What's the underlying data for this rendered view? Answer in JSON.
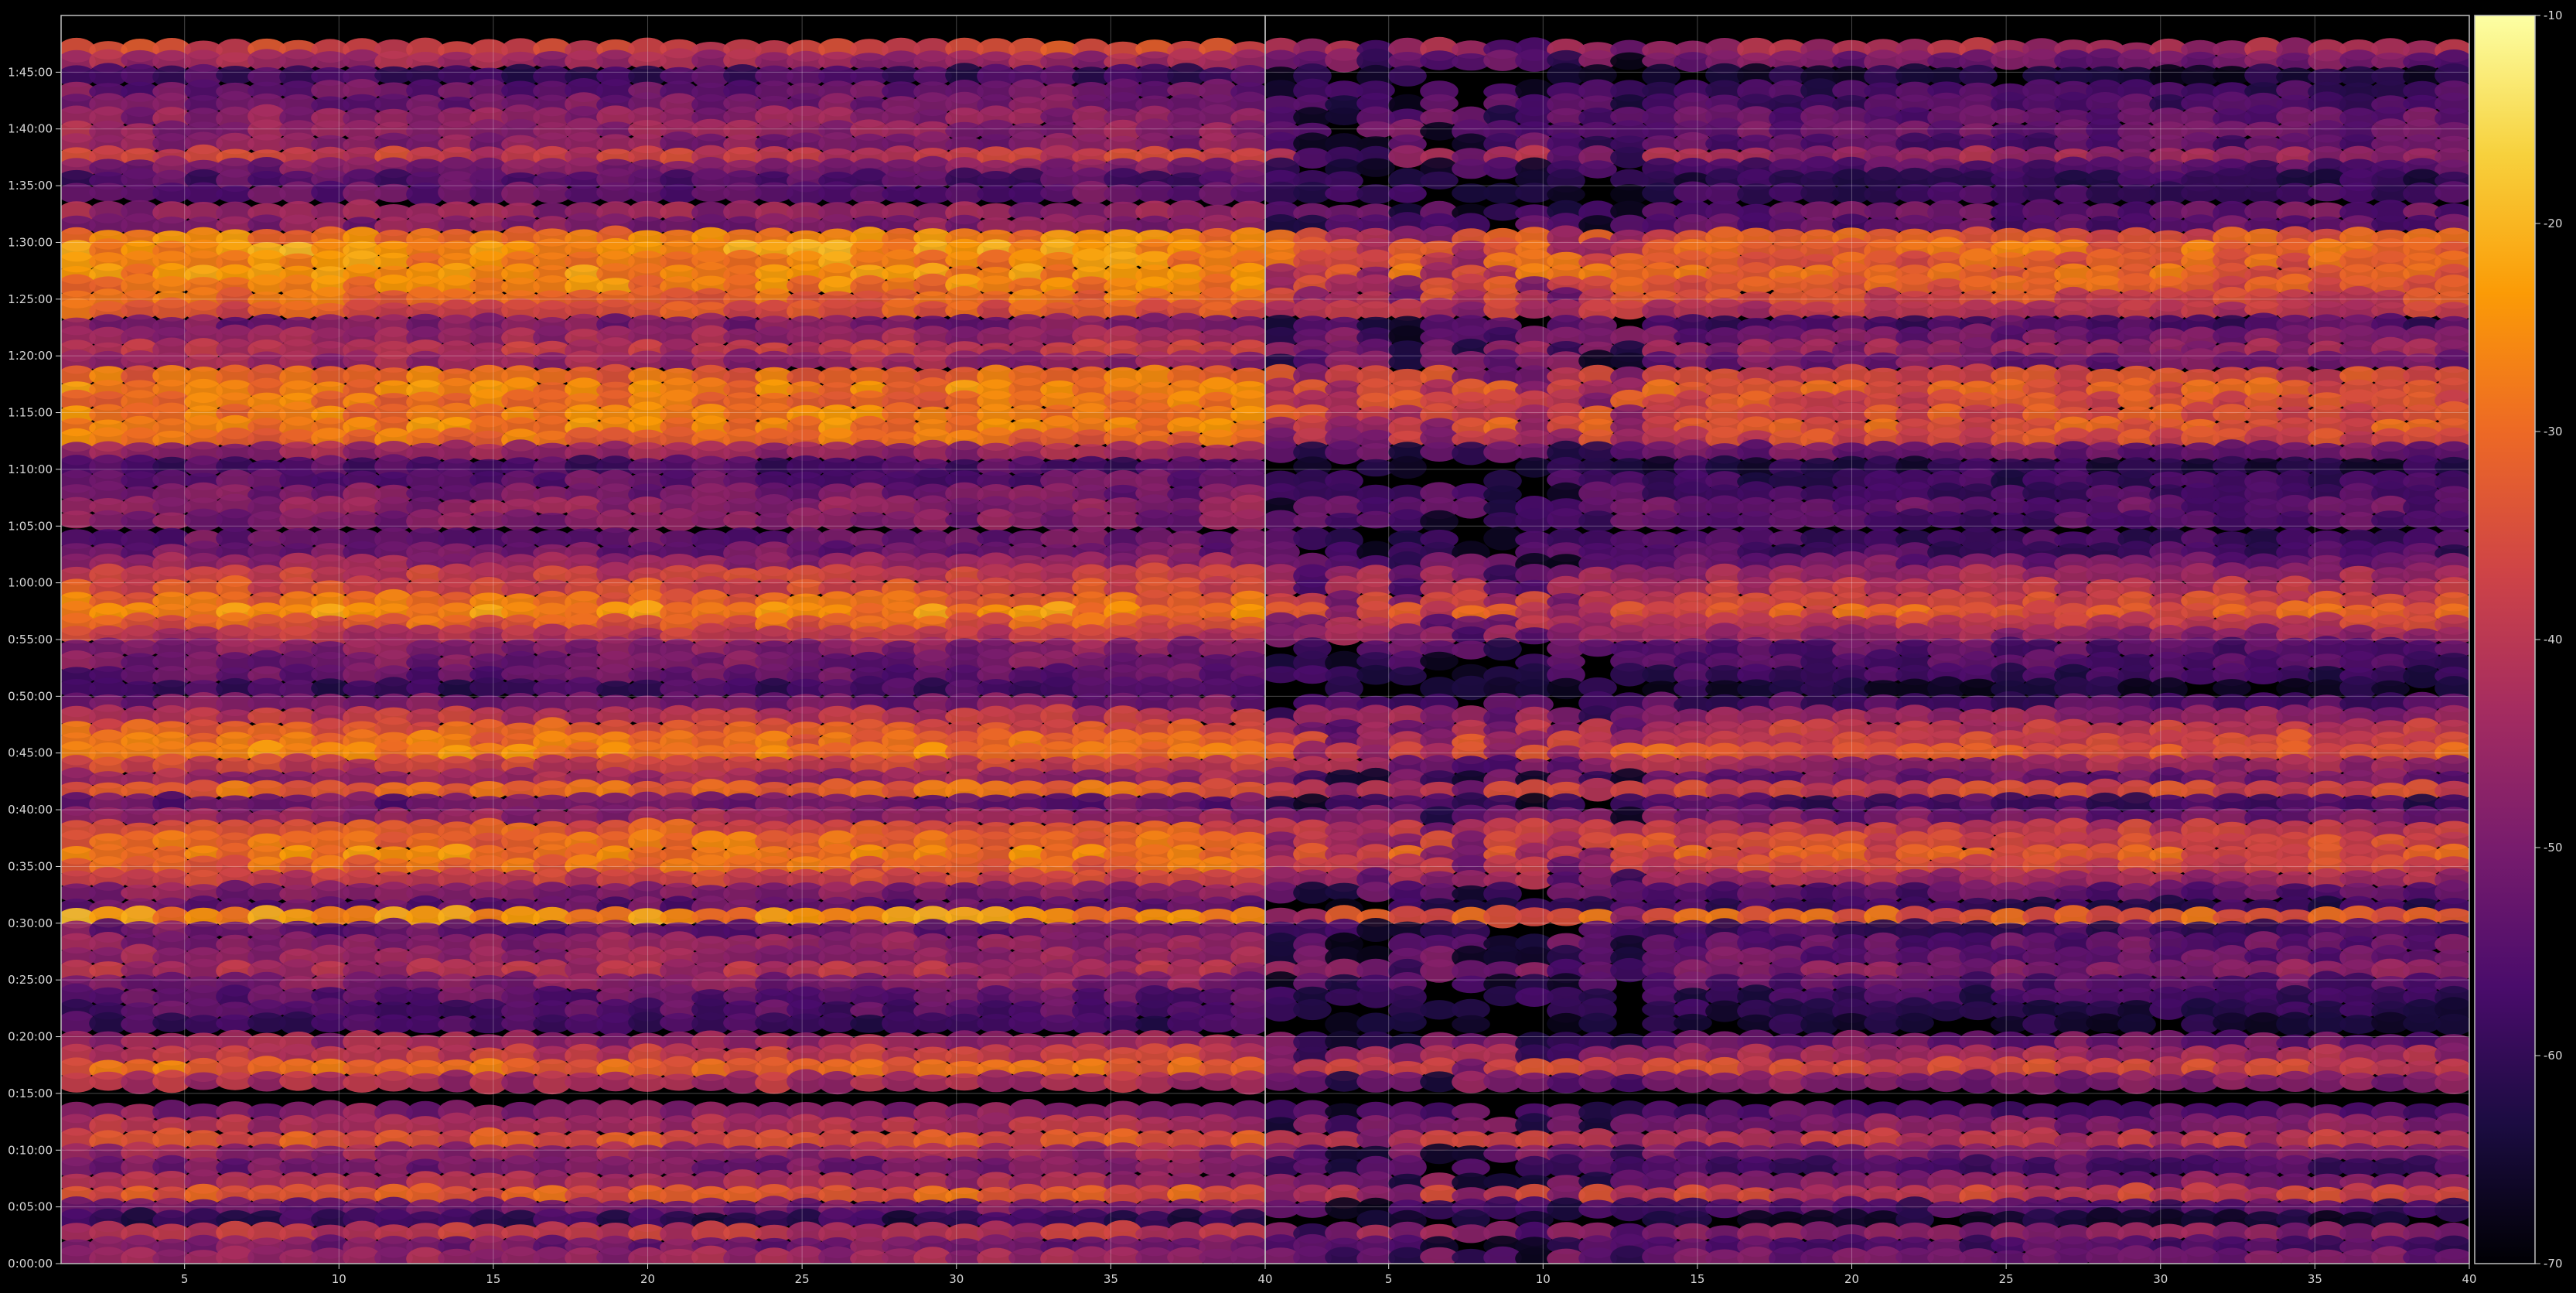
{
  "chart_data": {
    "type": "heatmap",
    "title": "",
    "xlabel": "",
    "ylabel": "",
    "grid": true,
    "background": "#000000",
    "colormap": "inferno",
    "colormap_stops": [
      "#000004",
      "#1b0c41",
      "#4a0c6b",
      "#781c6d",
      "#a52c60",
      "#cf4446",
      "#ed6925",
      "#fb9b06",
      "#f7d13d",
      "#fcffa4"
    ],
    "panels": [
      {
        "name": "left",
        "xlim": [
          1,
          40
        ],
        "xticks": [
          5,
          10,
          15,
          20,
          25,
          30,
          35,
          40
        ],
        "xtick_labels": [
          "5",
          "10",
          "15",
          "20",
          "25",
          "30",
          "35",
          "40"
        ]
      },
      {
        "name": "right",
        "xlim": [
          1,
          40
        ],
        "xticks": [
          5,
          10,
          15,
          20,
          25,
          30,
          35,
          40
        ],
        "xtick_labels": [
          "5",
          "10",
          "15",
          "20",
          "25",
          "30",
          "35",
          "40"
        ]
      }
    ],
    "y_axis": {
      "unit": "seconds",
      "ylim": [
        0,
        6600
      ],
      "ticks": [
        0,
        300,
        600,
        900,
        1200,
        1500,
        1800,
        2100,
        2400,
        2700,
        3000,
        3300,
        3600,
        3900,
        4200,
        4500,
        4800,
        5100,
        5400,
        5700,
        6000,
        6300
      ],
      "tick_labels": [
        "0:00:00",
        "0:05:00",
        "0:10:00",
        "0:15:00",
        "0:20:00",
        "0:25:00",
        "0:30:00",
        "0:35:00",
        "0:40:00",
        "0:45:00",
        "0:50:00",
        "0:55:00",
        "1:00:00",
        "1:05:00",
        "1:10:00",
        "1:15:00",
        "1:20:00",
        "1:25:00",
        "1:30:00",
        "1:35:00",
        "1:40:00",
        "1:45:00"
      ]
    },
    "colorbar": {
      "range": [
        -70,
        -10
      ],
      "ticks": [
        -10,
        -20,
        -30,
        -40,
        -50,
        -60,
        -70
      ],
      "tick_labels": [
        "-10",
        "-20",
        "-30",
        "-40",
        "-50",
        "-60",
        "-70"
      ]
    },
    "bands": [
      {
        "t": 6418,
        "level": -36
      },
      {
        "t": 6360,
        "level": -45
      },
      {
        "t": 6280,
        "level": -58
      },
      {
        "t": 6200,
        "level": -52
      },
      {
        "t": 6130,
        "level": -50
      },
      {
        "t": 6060,
        "level": -47
      },
      {
        "t": 5990,
        "level": -46
      },
      {
        "t": 5920,
        "level": -48
      },
      {
        "t": 5850,
        "level": -38
      },
      {
        "t": 5790,
        "level": -50
      },
      {
        "t": 5730,
        "level": -55
      },
      {
        "t": 5660,
        "level": -53
      },
      {
        "t": 5560,
        "level": -46
      },
      {
        "t": 5490,
        "level": -48
      },
      {
        "t": 5420,
        "level": -27
      },
      {
        "t": 5360,
        "level": -24
      },
      {
        "t": 5300,
        "level": -26
      },
      {
        "t": 5230,
        "level": -25
      },
      {
        "t": 5170,
        "level": -27
      },
      {
        "t": 5100,
        "level": -30
      },
      {
        "t": 5040,
        "level": -34
      },
      {
        "t": 4960,
        "level": -50
      },
      {
        "t": 4900,
        "level": -45
      },
      {
        "t": 4830,
        "level": -40
      },
      {
        "t": 4770,
        "level": -45
      },
      {
        "t": 4690,
        "level": -30
      },
      {
        "t": 4620,
        "level": -27
      },
      {
        "t": 4560,
        "level": -29
      },
      {
        "t": 4490,
        "level": -28
      },
      {
        "t": 4420,
        "level": -27
      },
      {
        "t": 4360,
        "level": -30
      },
      {
        "t": 4290,
        "level": -45
      },
      {
        "t": 4210,
        "level": -56
      },
      {
        "t": 4140,
        "level": -53
      },
      {
        "t": 4070,
        "level": -50
      },
      {
        "t": 4000,
        "level": -47
      },
      {
        "t": 3930,
        "level": -49
      },
      {
        "t": 3830,
        "level": -52
      },
      {
        "t": 3760,
        "level": -51
      },
      {
        "t": 3700,
        "level": -45
      },
      {
        "t": 3640,
        "level": -38
      },
      {
        "t": 3570,
        "level": -35
      },
      {
        "t": 3500,
        "level": -30
      },
      {
        "t": 3440,
        "level": -26
      },
      {
        "t": 3380,
        "level": -32
      },
      {
        "t": 3320,
        "level": -40
      },
      {
        "t": 3250,
        "level": -48
      },
      {
        "t": 3180,
        "level": -50
      },
      {
        "t": 3110,
        "level": -53
      },
      {
        "t": 3040,
        "level": -58
      },
      {
        "t": 2960,
        "level": -50
      },
      {
        "t": 2890,
        "level": -40
      },
      {
        "t": 2820,
        "level": -33
      },
      {
        "t": 2760,
        "level": -30
      },
      {
        "t": 2700,
        "level": -27
      },
      {
        "t": 2630,
        "level": -38
      },
      {
        "t": 2560,
        "level": -45
      },
      {
        "t": 2500,
        "level": -30
      },
      {
        "t": 2430,
        "level": -52
      },
      {
        "t": 2360,
        "level": -45
      },
      {
        "t": 2290,
        "level": -33
      },
      {
        "t": 2230,
        "level": -30
      },
      {
        "t": 2160,
        "level": -27
      },
      {
        "t": 2100,
        "level": -31
      },
      {
        "t": 2030,
        "level": -38
      },
      {
        "t": 1960,
        "level": -48
      },
      {
        "t": 1880,
        "level": -53
      },
      {
        "t": 1830,
        "level": -25
      },
      {
        "t": 1760,
        "level": -52
      },
      {
        "t": 1690,
        "level": -47
      },
      {
        "t": 1620,
        "level": -46
      },
      {
        "t": 1550,
        "level": -42
      },
      {
        "t": 1480,
        "level": -48
      },
      {
        "t": 1410,
        "level": -53
      },
      {
        "t": 1340,
        "level": -55
      },
      {
        "t": 1270,
        "level": -58
      },
      {
        "t": 1170,
        "level": -45
      },
      {
        "t": 1100,
        "level": -38
      },
      {
        "t": 1030,
        "level": -30
      },
      {
        "t": 960,
        "level": -42
      },
      {
        "t": 800,
        "level": -48
      },
      {
        "t": 730,
        "level": -42
      },
      {
        "t": 650,
        "level": -34
      },
      {
        "t": 580,
        "level": -45
      },
      {
        "t": 510,
        "level": -50
      },
      {
        "t": 430,
        "level": -43
      },
      {
        "t": 360,
        "level": -32
      },
      {
        "t": 290,
        "level": -50
      },
      {
        "t": 230,
        "level": -60
      },
      {
        "t": 160,
        "level": -40
      },
      {
        "t": 90,
        "level": -50
      },
      {
        "t": 30,
        "level": -45
      }
    ],
    "right_panel_attenuation_db": 6
  }
}
